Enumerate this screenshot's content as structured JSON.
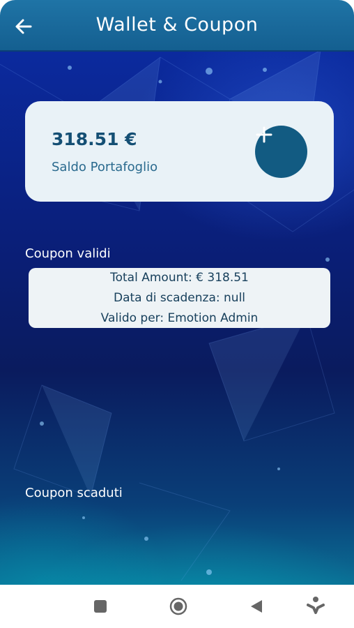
{
  "header": {
    "title": "Wallet & Coupon",
    "back_icon": "arrow-left-icon"
  },
  "wallet": {
    "balance": "318.51 €",
    "balance_label": "Saldo Portafoglio",
    "add_icon": "plus-icon"
  },
  "sections": {
    "valid_label": "Coupon validi",
    "expired_label": "Coupon scaduti"
  },
  "coupons_valid": [
    {
      "total": "Total Amount: € 318.51",
      "expiry": "Data di scadenza: null",
      "valid_for": "Valido per: Emotion Admin"
    }
  ],
  "navbar": {
    "icons": [
      "square-icon",
      "circle-home-icon",
      "triangle-back-icon",
      "accessibility-icon"
    ]
  },
  "colors": {
    "appbar": "#1a6a9c",
    "card_bg": "#e9f2f7",
    "accent": "#125b82",
    "text_dark": "#144f74"
  }
}
